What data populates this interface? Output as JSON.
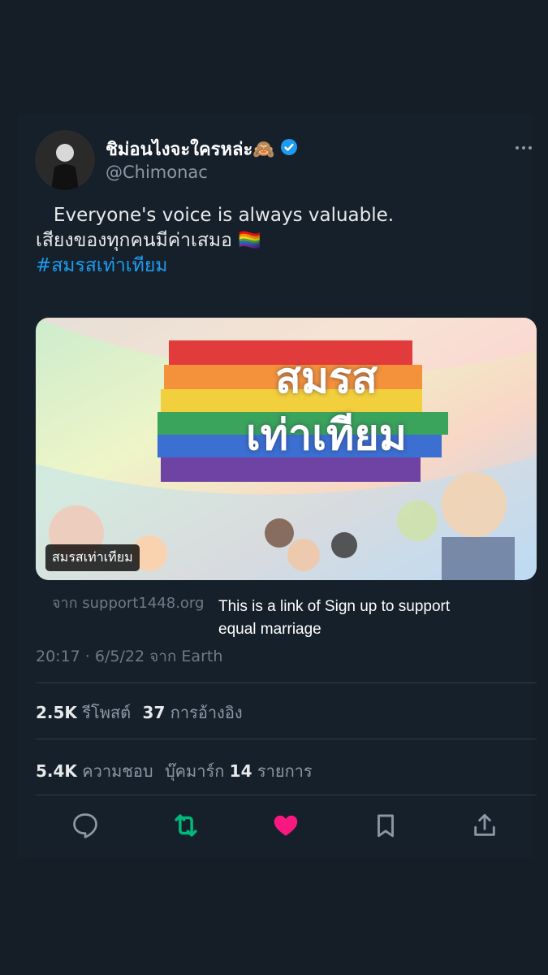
{
  "author": {
    "display_name": "ชิม่อนไงจะใครหล่ะ🙈",
    "handle": "@Chimonac",
    "verified": true
  },
  "tweet": {
    "line1": "   Everyone's voice is always valuable.",
    "line2": "เสียงของทุกคนมีค่าเสมอ 🏳️‍🌈",
    "hashtag": "#สมรสเท่าเทียม"
  },
  "media": {
    "headline_top": "สมรส",
    "headline_bottom": "เท่าเทียม",
    "label": "สมรสเท่าเทียม"
  },
  "link": {
    "source": "จาก support1448.org"
  },
  "overlay_note": "This is a link of Sign up to support equal marriage",
  "meta": {
    "timestamp": "20:17 · 6/5/22 จาก Earth"
  },
  "stats": {
    "reposts_count": "2.5K",
    "reposts_label": "รีโพสต์",
    "quotes_count": "37",
    "quotes_label": "การอ้างอิง",
    "likes_count": "5.4K",
    "likes_label": "ความชอบ",
    "bookmarks_label": "บุ๊คมาร์ก",
    "bookmarks_count": "14",
    "bookmarks_suffix": "รายการ"
  },
  "colors": {
    "background": "#151d27",
    "accent": "#1d9bf0",
    "repost": "#00ba7c",
    "like": "#f91880"
  },
  "icons": [
    "more-icon",
    "verified-icon",
    "reply-icon",
    "repost-icon",
    "like-icon",
    "bookmark-icon",
    "share-icon"
  ]
}
